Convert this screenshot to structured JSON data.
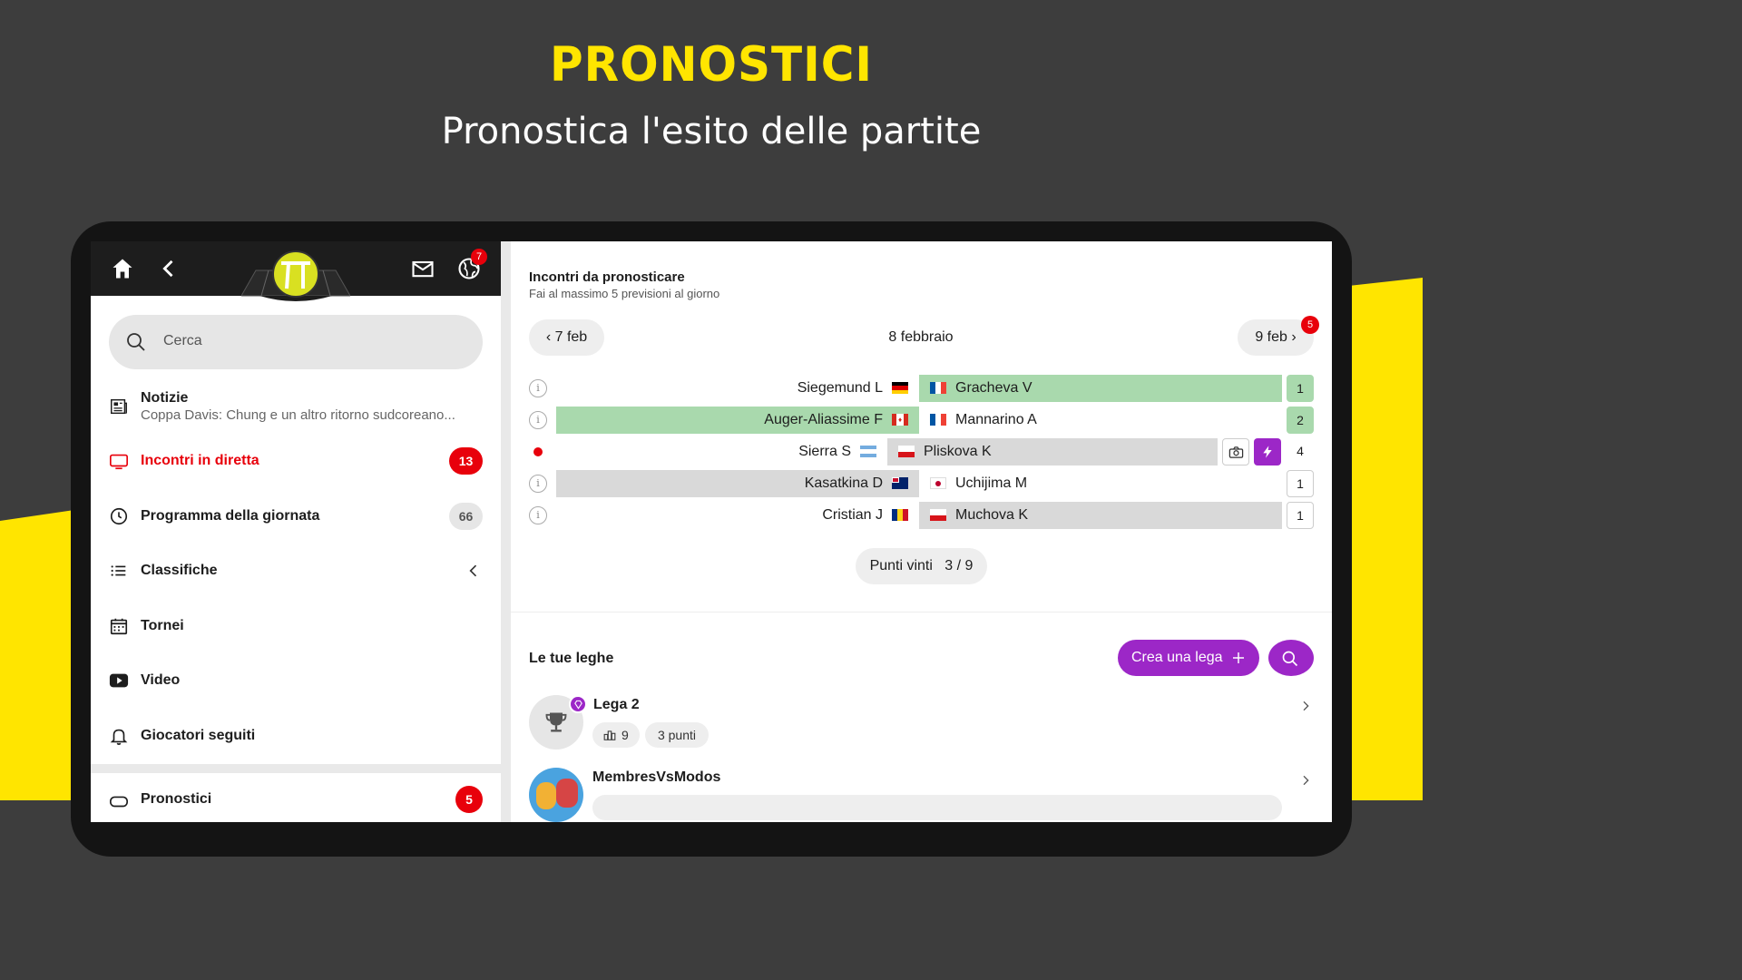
{
  "hero": {
    "title": "PRONOSTICI",
    "subtitle": "Pronostica l'esito delle partite"
  },
  "sidebar": {
    "notification_badge": "7",
    "search_placeholder": "Cerca",
    "items": [
      {
        "label": "Notizie",
        "sub": "Coppa Davis: Chung e un altro ritorno sudcoreano...",
        "icon": "newspaper-icon"
      },
      {
        "label": "Incontri in diretta",
        "count": "13",
        "icon": "tv-icon"
      },
      {
        "label": "Programma della giornata",
        "count": "66",
        "icon": "clock-icon"
      },
      {
        "label": "Classifiche",
        "icon": "list-icon"
      },
      {
        "label": "Tornei",
        "icon": "calendar-icon"
      },
      {
        "label": "Video",
        "icon": "play-icon"
      },
      {
        "label": "Giocatori seguiti",
        "icon": "bell-icon"
      },
      {
        "label": "Pronostici",
        "count": "5",
        "icon": "gamepad-icon"
      }
    ]
  },
  "predictions": {
    "title": "Incontri da pronosticare",
    "subtitle": "Fai al massimo 5 previsioni al giorno",
    "prev_day": "7 feb",
    "current_day": "8 febbraio",
    "next_day": "9 feb",
    "next_badge": "5",
    "matches": [
      {
        "left": "Siegemund L",
        "right": "Gracheva V",
        "result": "1",
        "winner": "right",
        "state": "info"
      },
      {
        "left": "Auger-Aliassime F",
        "right": "Mannarino A",
        "result": "2",
        "winner": "left",
        "state": "info"
      },
      {
        "left": "Sierra S",
        "right": "Pliskova K",
        "result": "4",
        "winner": "right-grey",
        "state": "live"
      },
      {
        "left": "Kasatkina D",
        "right": "Uchijima M",
        "result": "1",
        "winner": "left-grey",
        "state": "info"
      },
      {
        "left": "Cristian J",
        "right": "Muchova K",
        "result": "1",
        "winner": "right-grey",
        "state": "info"
      }
    ],
    "points_label": "Punti vinti",
    "points_value": "3 / 9"
  },
  "leagues": {
    "title": "Le tue leghe",
    "create_label": "Crea una lega",
    "items": [
      {
        "name": "Lega 2",
        "members": "9",
        "points": "3 punti"
      },
      {
        "name": "MembresVsModos"
      }
    ]
  },
  "colors": {
    "accent_yellow": "#ffe500",
    "purple": "#9c27c7",
    "live_red": "#e8000b",
    "win_green": "#a9d9ad"
  }
}
